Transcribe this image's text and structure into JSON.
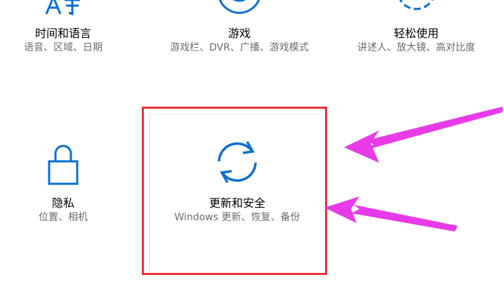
{
  "colors": {
    "accent": "#0a6fd0",
    "highlight": "#e8323c",
    "arrow": "#e83be8",
    "title": "#000000",
    "desc": "#6b6b6b"
  },
  "tiles": {
    "time_language": {
      "title": "时间和语言",
      "desc": "语音、区域、日期",
      "icon": "language-icon"
    },
    "gaming": {
      "title": "游戏",
      "desc": "游戏栏、DVR、广播、游戏模式",
      "icon": "xbox-icon"
    },
    "ease_of_access": {
      "title": "轻松使用",
      "desc": "讲述人、放大镜、高对比度",
      "icon": "ease-of-access-icon"
    },
    "privacy": {
      "title": "隐私",
      "desc": "位置、相机",
      "icon": "lock-icon"
    },
    "update_security": {
      "title": "更新和安全",
      "desc": "Windows 更新、恢复、备份",
      "icon": "sync-icon"
    }
  }
}
